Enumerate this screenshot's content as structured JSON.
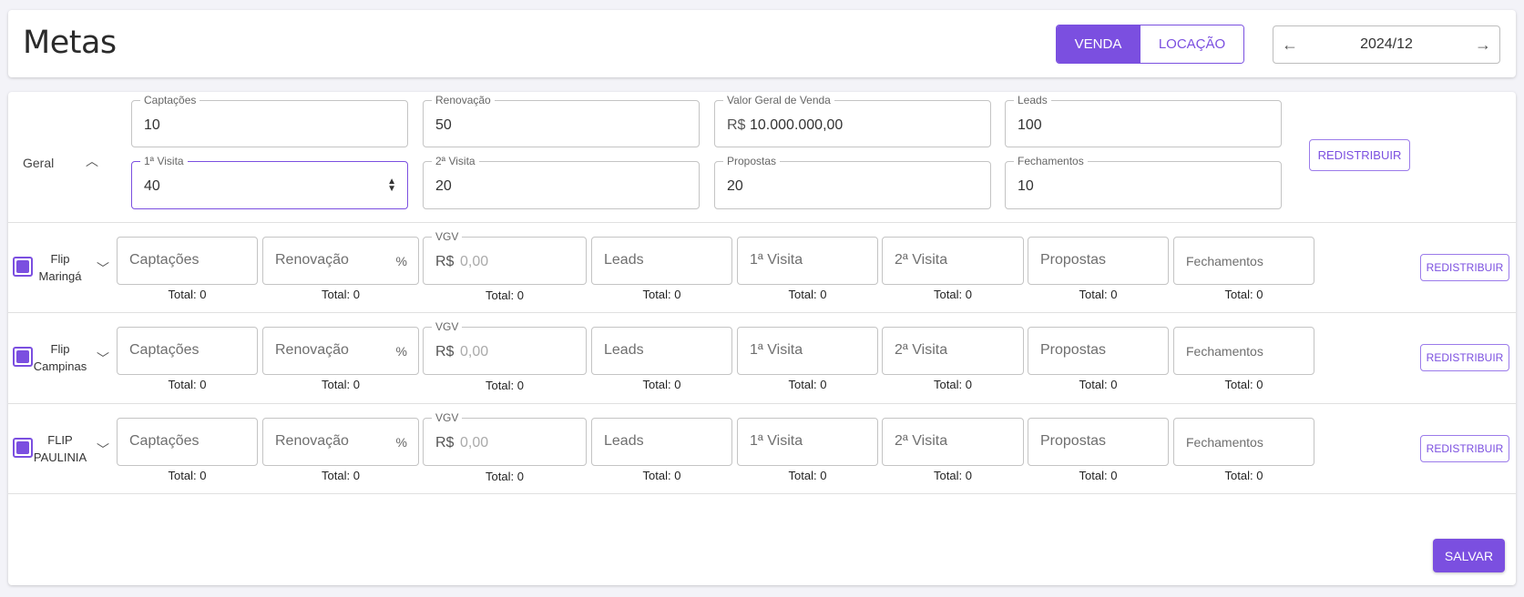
{
  "header": {
    "title": "Metas",
    "mode_venda": "VENDA",
    "mode_locacao": "LOCAÇÃO",
    "period": "2024/12",
    "accent": "#7b4fe0"
  },
  "geral": {
    "label": "Geral",
    "captacoes": {
      "label": "Captações",
      "value": "10"
    },
    "renovacao": {
      "label": "Renovação",
      "value": "50"
    },
    "vgv": {
      "label": "Valor Geral de Venda",
      "prefix": "R$",
      "value": "10.000.000,00"
    },
    "leads": {
      "label": "Leads",
      "value": "100"
    },
    "visita1": {
      "label": "1ª Visita",
      "value": "40"
    },
    "visita2": {
      "label": "2ª Visita",
      "value": "20"
    },
    "propostas": {
      "label": "Propostas",
      "value": "20"
    },
    "fechamentos": {
      "label": "Fechamentos",
      "value": "10"
    },
    "redistribuir": "REDISTRIBUIR"
  },
  "fields": {
    "captacoes": "Captações",
    "renovacao": "Renovação",
    "pct": "%",
    "vgv_label": "VGV",
    "vgv_prefix": "R$",
    "vgv_placeholder": "0,00",
    "leads": "Leads",
    "visita1": "1ª Visita",
    "visita2": "2ª Visita",
    "propostas": "Propostas",
    "fechamentos": "Fechamentos",
    "total": "Total: 0",
    "redistribuir": "REDISTRIBUIR"
  },
  "units": [
    {
      "line1": "Flip",
      "line2": "Maringá"
    },
    {
      "line1": "Flip",
      "line2": "Campinas"
    },
    {
      "line1": "FLIP",
      "line2": "PAULINIA"
    }
  ],
  "save_label": "SALVAR"
}
